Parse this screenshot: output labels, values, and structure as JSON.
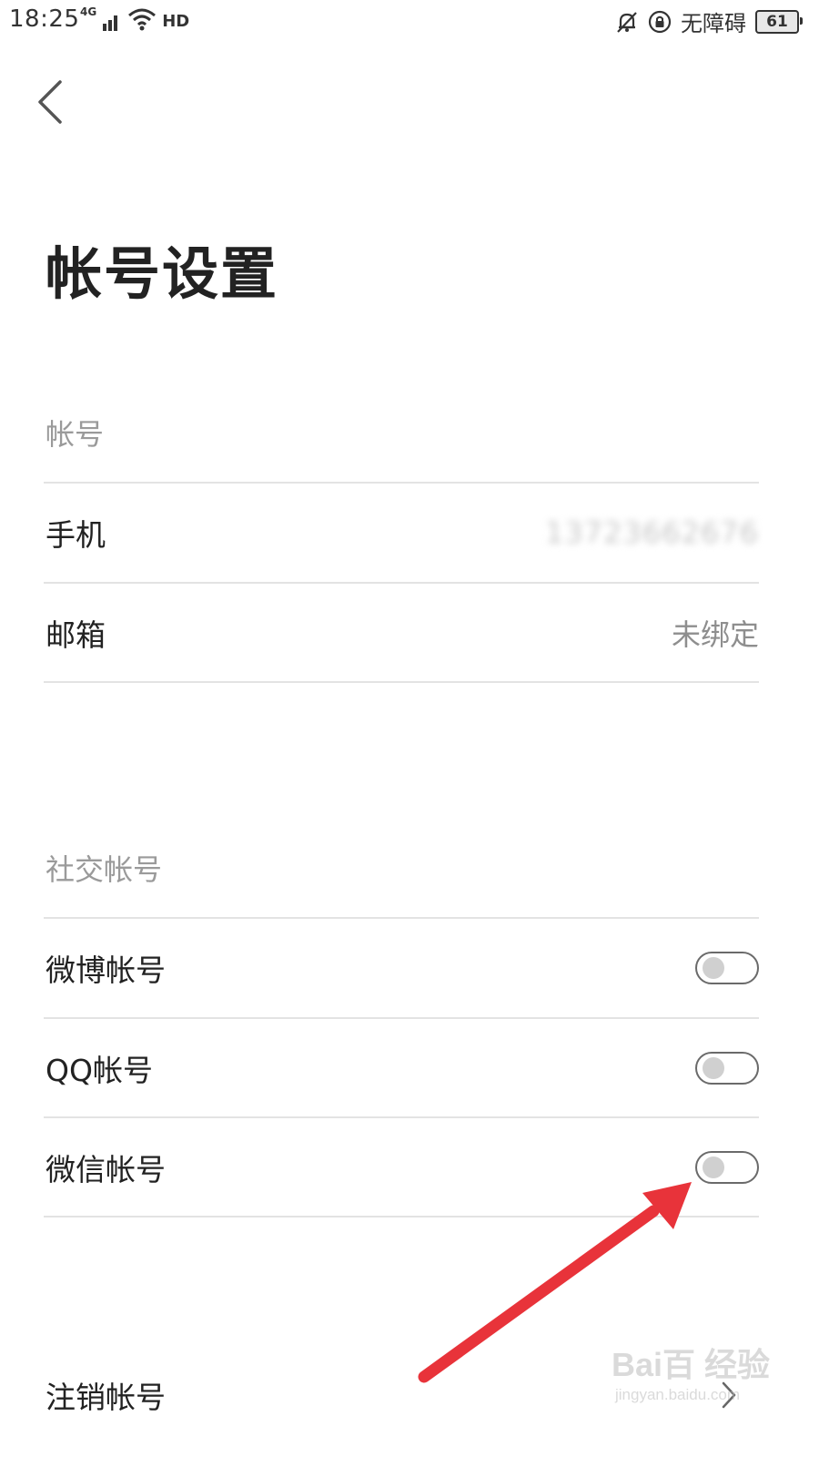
{
  "status_bar": {
    "time": "18:25",
    "network": "4G",
    "hd": "HD",
    "accessibility": "无障碍",
    "battery": "61"
  },
  "page": {
    "title": "帐号设置"
  },
  "account_section": {
    "header": "帐号",
    "rows": [
      {
        "label": "手机",
        "value": "13723662676"
      },
      {
        "label": "邮箱",
        "value": "未绑定"
      }
    ]
  },
  "social_section": {
    "header": "社交帐号",
    "rows": [
      {
        "label": "微博帐号",
        "enabled": false
      },
      {
        "label": "QQ帐号",
        "enabled": false
      },
      {
        "label": "微信帐号",
        "enabled": false
      }
    ]
  },
  "footer_row": {
    "label": "注销帐号"
  },
  "annotation": {
    "color": "#e8333a"
  },
  "watermark": {
    "main": "Bai百 经验",
    "sub": "jingyan.baidu.com"
  }
}
